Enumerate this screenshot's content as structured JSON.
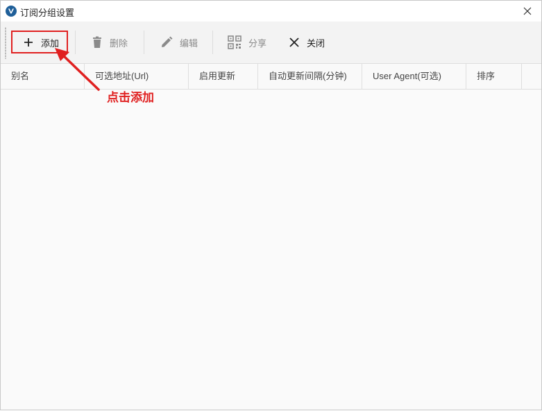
{
  "window": {
    "title": "订阅分组设置",
    "close_icon": "close-icon"
  },
  "toolbar": {
    "buttons": [
      {
        "label": "添加",
        "icon": "plus-icon",
        "enabled": true
      },
      {
        "label": "删除",
        "icon": "trash-icon",
        "enabled": false
      },
      {
        "label": "编辑",
        "icon": "pencil-icon",
        "enabled": false
      },
      {
        "label": "分享",
        "icon": "qr-code-icon",
        "enabled": false
      },
      {
        "label": "关闭",
        "icon": "close-icon",
        "enabled": true
      }
    ]
  },
  "grid": {
    "columns": [
      "别名",
      "可选地址(Url)",
      "启用更新",
      "自动更新间隔(分钟)",
      "User Agent(可选)",
      "排序"
    ],
    "rows": []
  },
  "annotation": {
    "text": "点击添加",
    "color": "#e02020"
  }
}
